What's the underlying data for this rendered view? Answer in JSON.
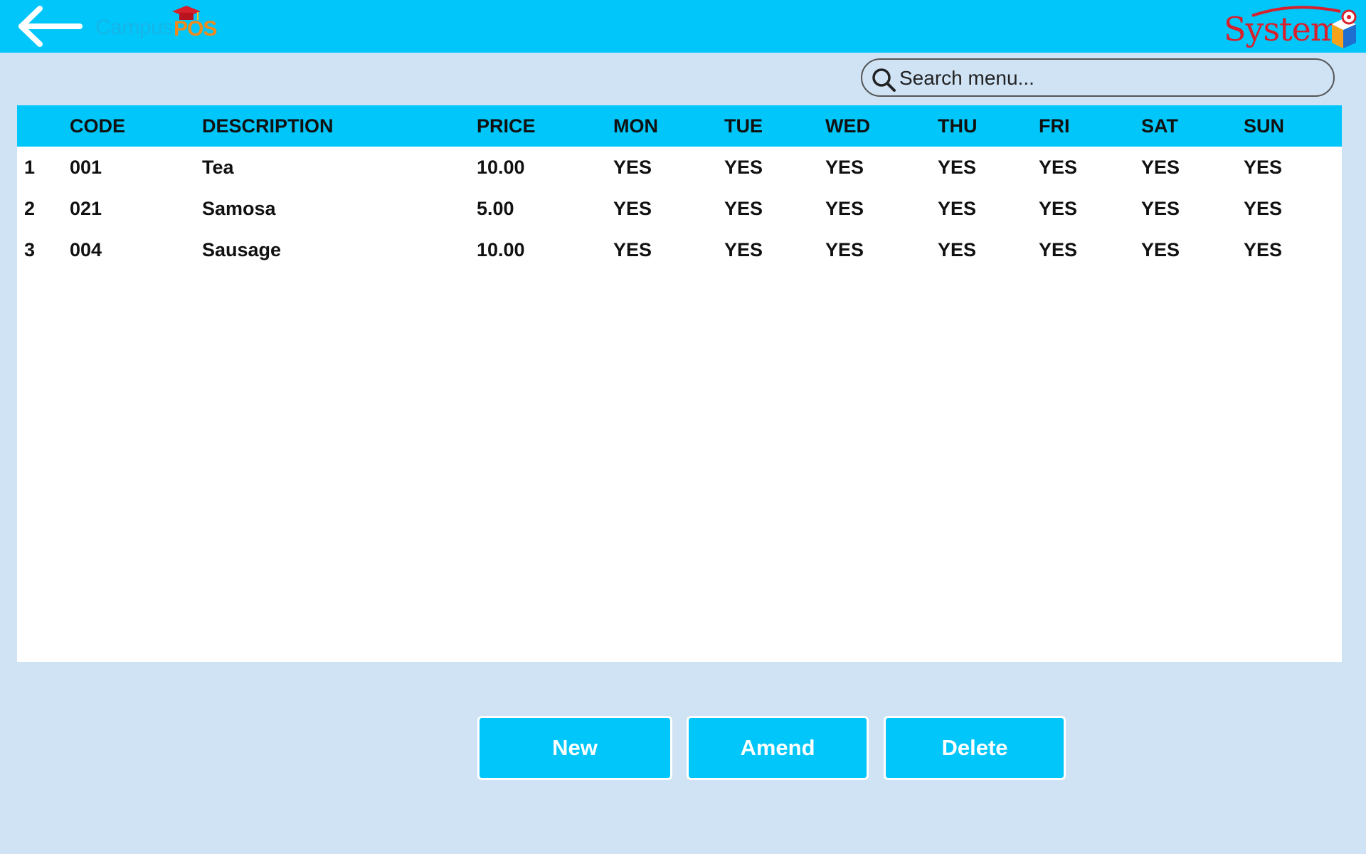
{
  "header": {
    "logo_left": {
      "campus": "Campus",
      "pos": "POS"
    },
    "logo_right": {
      "system": "System"
    }
  },
  "search": {
    "placeholder": "Search menu...",
    "value": ""
  },
  "table": {
    "columns": [
      "",
      "CODE",
      "DESCRIPTION",
      "PRICE",
      "MON",
      "TUE",
      "WED",
      "THU",
      "FRI",
      "SAT",
      "SUN"
    ],
    "rows": [
      [
        "1",
        "001",
        "Tea",
        "10.00",
        "YES",
        "YES",
        "YES",
        "YES",
        "YES",
        "YES",
        "YES"
      ],
      [
        "2",
        "021",
        "Samosa",
        "5.00",
        "YES",
        "YES",
        "YES",
        "YES",
        "YES",
        "YES",
        "YES"
      ],
      [
        "3",
        "004",
        "Sausage",
        "10.00",
        "YES",
        "YES",
        "YES",
        "YES",
        "YES",
        "YES",
        "YES"
      ]
    ]
  },
  "actions": {
    "new_label": "New",
    "amend_label": "Amend",
    "delete_label": "Delete"
  },
  "colors": {
    "accent": "#00c6fa",
    "background": "#d0e3f5",
    "panel": "#ffffff",
    "brand_red": "#d8202c",
    "brand_orange": "#f08a1c"
  },
  "icons": {
    "back": "arrow-left-icon",
    "search": "search-icon"
  }
}
